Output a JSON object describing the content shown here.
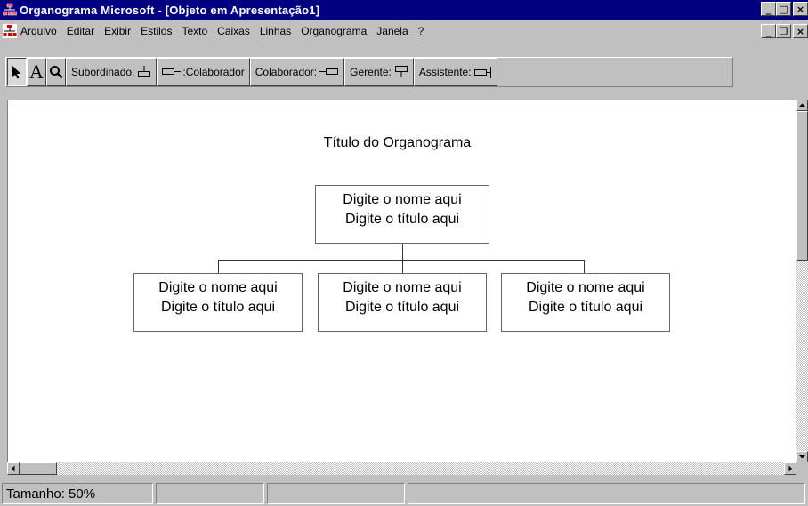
{
  "window": {
    "title": "Organograma Microsoft - [Objeto em Apresentação1]",
    "controls": {
      "minimize": "_",
      "maximize": "□",
      "close": "×"
    }
  },
  "menu": {
    "items": [
      {
        "pre": "",
        "key": "A",
        "rest": "rquivo"
      },
      {
        "pre": "",
        "key": "E",
        "rest": "ditar"
      },
      {
        "pre": "E",
        "key": "x",
        "rest": "ibir"
      },
      {
        "pre": "E",
        "key": "s",
        "rest": "tilos"
      },
      {
        "pre": "",
        "key": "T",
        "rest": "exto"
      },
      {
        "pre": "",
        "key": "C",
        "rest": "aixas"
      },
      {
        "pre": "",
        "key": "L",
        "rest": "inhas"
      },
      {
        "pre": "",
        "key": "O",
        "rest": "rganograma"
      },
      {
        "pre": "",
        "key": "J",
        "rest": "anela"
      },
      {
        "pre": "",
        "key": "?",
        "rest": ""
      }
    ],
    "mdi_controls": {
      "minimize": "_",
      "restore": "❐",
      "close": "×"
    }
  },
  "toolbar": {
    "select_tool": "pointer-arrow-icon",
    "text_tool": "A",
    "zoom_tool": "magnifier-icon",
    "subordinate": "Subordinado:",
    "colleague_left_suffix": ":Colaborador",
    "colleague_right": "Colaborador:",
    "manager": "Gerente:",
    "assistant": "Assistente:"
  },
  "chart": {
    "title": "Título do Organograma",
    "root": {
      "name": "Digite o nome aqui",
      "role": "Digite o título aqui"
    },
    "children": [
      {
        "name": "Digite o nome aqui",
        "role": "Digite o título aqui"
      },
      {
        "name": "Digite o nome aqui",
        "role": "Digite o título aqui"
      },
      {
        "name": "Digite o nome aqui",
        "role": "Digite o título aqui"
      }
    ]
  },
  "status": {
    "zoom": "Tamanho: 50%",
    "pane2": "",
    "pane3": "",
    "pane4": ""
  },
  "colors": {
    "titlebar": "#000080",
    "face": "#c0c0c0",
    "canvas": "#ffffff"
  }
}
